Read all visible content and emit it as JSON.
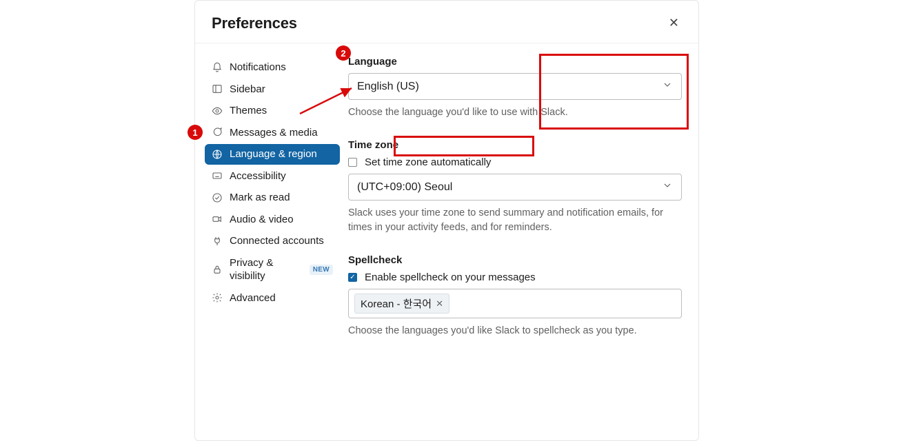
{
  "header": {
    "title": "Preferences"
  },
  "sidebar": {
    "items": [
      {
        "label": "Notifications"
      },
      {
        "label": "Sidebar"
      },
      {
        "label": "Themes"
      },
      {
        "label": "Messages & media"
      },
      {
        "label": "Language & region"
      },
      {
        "label": "Accessibility"
      },
      {
        "label": "Mark as read"
      },
      {
        "label": "Audio & video"
      },
      {
        "label": "Connected accounts"
      },
      {
        "label": "Privacy & visibility",
        "badge": "NEW"
      },
      {
        "label": "Advanced"
      }
    ],
    "active_index": 4
  },
  "language": {
    "label": "Language",
    "value": "English (US)",
    "helper": "Choose the language you'd like to use with Slack."
  },
  "timezone": {
    "label": "Time zone",
    "auto_label": "Set time zone automatically",
    "auto_checked": false,
    "value": "(UTC+09:00) Seoul",
    "helper": "Slack uses your time zone to send summary and notification emails, for times in your activity feeds, and for reminders."
  },
  "spellcheck": {
    "label": "Spellcheck",
    "enable_label": "Enable spellcheck on your messages",
    "enable_checked": true,
    "chip": "Korean - 한국어",
    "helper": "Choose the languages you'd like Slack to spellcheck as you type."
  },
  "annotations": {
    "n1": "1",
    "n2": "2"
  }
}
